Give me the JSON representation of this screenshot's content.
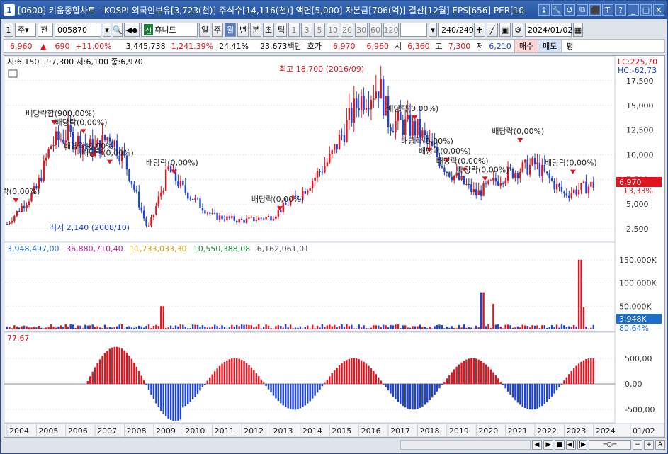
{
  "window": {
    "number": "1",
    "title": "[0600] 키움종합차트 - KOSPI 외국인보유[3,723(천)] 주식수[14,116(천)] 액면[5,000] 자본금[706(억)] 결산[12월] EPS[656] PER[10",
    "buttons": [
      "↕",
      "🔧",
      "↺",
      "⧉",
      "⬛",
      "T",
      "?",
      "_",
      "□",
      "✕"
    ]
  },
  "toolbar": {
    "number": "1",
    "dropdown1": "주",
    "dropdown2": "전",
    "code": "005870",
    "badge": "신",
    "name": "휴니드",
    "periods": [
      "일",
      "주",
      "월",
      "년",
      "분",
      "초",
      "틱"
    ],
    "selected_period": "월",
    "counts": [
      "1",
      "3",
      "5",
      "10",
      "20",
      "30",
      "60",
      "120"
    ],
    "range": "240/240",
    "date": "2024/01/02"
  },
  "quote": {
    "price": "6,960",
    "arrow": "▲",
    "change": "690",
    "pct": "+11.00%",
    "volume": "3,445,738",
    "vol_ratio": "1,241.39%",
    "turnover": "24.41%",
    "amount": "23,673백만",
    "label_hoga": "호가",
    "ask": "6,970",
    "bid": "6,960",
    "label_open": "시",
    "open": "6,360",
    "label_high": "고",
    "high": "7,300",
    "label_low": "저",
    "low": "6,210",
    "buy_btn": "매수",
    "sell_btn": "매도",
    "avg_btn": "평"
  },
  "price_panel": {
    "info": "시:6,150 고:7,300 저:6,100 종:6,970",
    "lc": "LC:225,70",
    "hc": "HC:-62,73",
    "current_price": "6,970",
    "current_pct": "13,33%",
    "high_note": "최고 18,700 (2016/09)",
    "low_note": "최저 2,140 (2008/10)",
    "dividend_label": "배당락(0,00%)",
    "dividend_special": "배당락합(900,00%)",
    "y_ticks": [
      "17,500",
      "15,000",
      "12,500",
      "10,000",
      "7,500",
      "5,000",
      "2,500"
    ],
    "y_values": [
      17500,
      15000,
      12500,
      10000,
      7500,
      5000,
      2500
    ]
  },
  "volume_panel": {
    "legend": [
      {
        "text": "3,948,497,00",
        "color": "#1f6fc7"
      },
      {
        "text": "36,880,710,40",
        "color": "#b4239b"
      },
      {
        "text": "11,733,033,30",
        "color": "#d6a000"
      },
      {
        "text": "10,550,388,08",
        "color": "#1a8f3a"
      },
      {
        "text": "6,162,061,01",
        "color": "#555555"
      }
    ],
    "y_ticks": [
      "150,000K",
      "100,000K",
      "50,000K"
    ],
    "y_values": [
      150000,
      100000,
      50000
    ],
    "current": "3,948K",
    "current_pct": "80,64%"
  },
  "osc_panel": {
    "value": "77,67",
    "y_ticks": [
      "500,00",
      "0,00",
      "-500,00"
    ],
    "y_values": [
      500,
      0,
      -500
    ]
  },
  "x_axis": {
    "labels": [
      "2004",
      "2005",
      "2006",
      "2007",
      "2008",
      "2009",
      "2010",
      "2011",
      "2012",
      "2013",
      "2014",
      "2015",
      "2016",
      "2017",
      "2018",
      "2019",
      "2020",
      "2021",
      "2022",
      "2023",
      "2024",
      "01/02"
    ]
  },
  "colors": {
    "up": "#e0141e",
    "down": "#1d43d6",
    "titlebar": "#24529f"
  },
  "chart_data": {
    "type": "candlestick",
    "title": "휴니드 005870 월봉",
    "x_range": [
      "2004",
      "2024"
    ],
    "price_ylim": [
      1500,
      19000
    ],
    "price_series_monthly_approx": [
      {
        "year": 2004,
        "close": 3000
      },
      {
        "year": 2005,
        "close": 6500
      },
      {
        "year": 2005.5,
        "close": 11000
      },
      {
        "year": 2006,
        "close": 12000
      },
      {
        "year": 2007,
        "close": 10500
      },
      {
        "year": 2007.5,
        "close": 12000
      },
      {
        "year": 2008,
        "close": 9500
      },
      {
        "year": 2008.8,
        "close": 2400
      },
      {
        "year": 2009,
        "close": 4000
      },
      {
        "year": 2009.5,
        "close": 8500
      },
      {
        "year": 2010,
        "close": 6500
      },
      {
        "year": 2011,
        "close": 3800
      },
      {
        "year": 2012,
        "close": 3300
      },
      {
        "year": 2013,
        "close": 3700
      },
      {
        "year": 2014,
        "close": 6000
      },
      {
        "year": 2015,
        "close": 9500
      },
      {
        "year": 2016,
        "close": 15500
      },
      {
        "year": 2016.7,
        "close": 17000
      },
      {
        "year": 2017,
        "close": 13500
      },
      {
        "year": 2018,
        "close": 12500
      },
      {
        "year": 2019,
        "close": 8500
      },
      {
        "year": 2020,
        "close": 6000
      },
      {
        "year": 2021,
        "close": 8000
      },
      {
        "year": 2022,
        "close": 9000
      },
      {
        "year": 2023,
        "close": 6000
      },
      {
        "year": 2024,
        "close": 6970
      }
    ]
  }
}
